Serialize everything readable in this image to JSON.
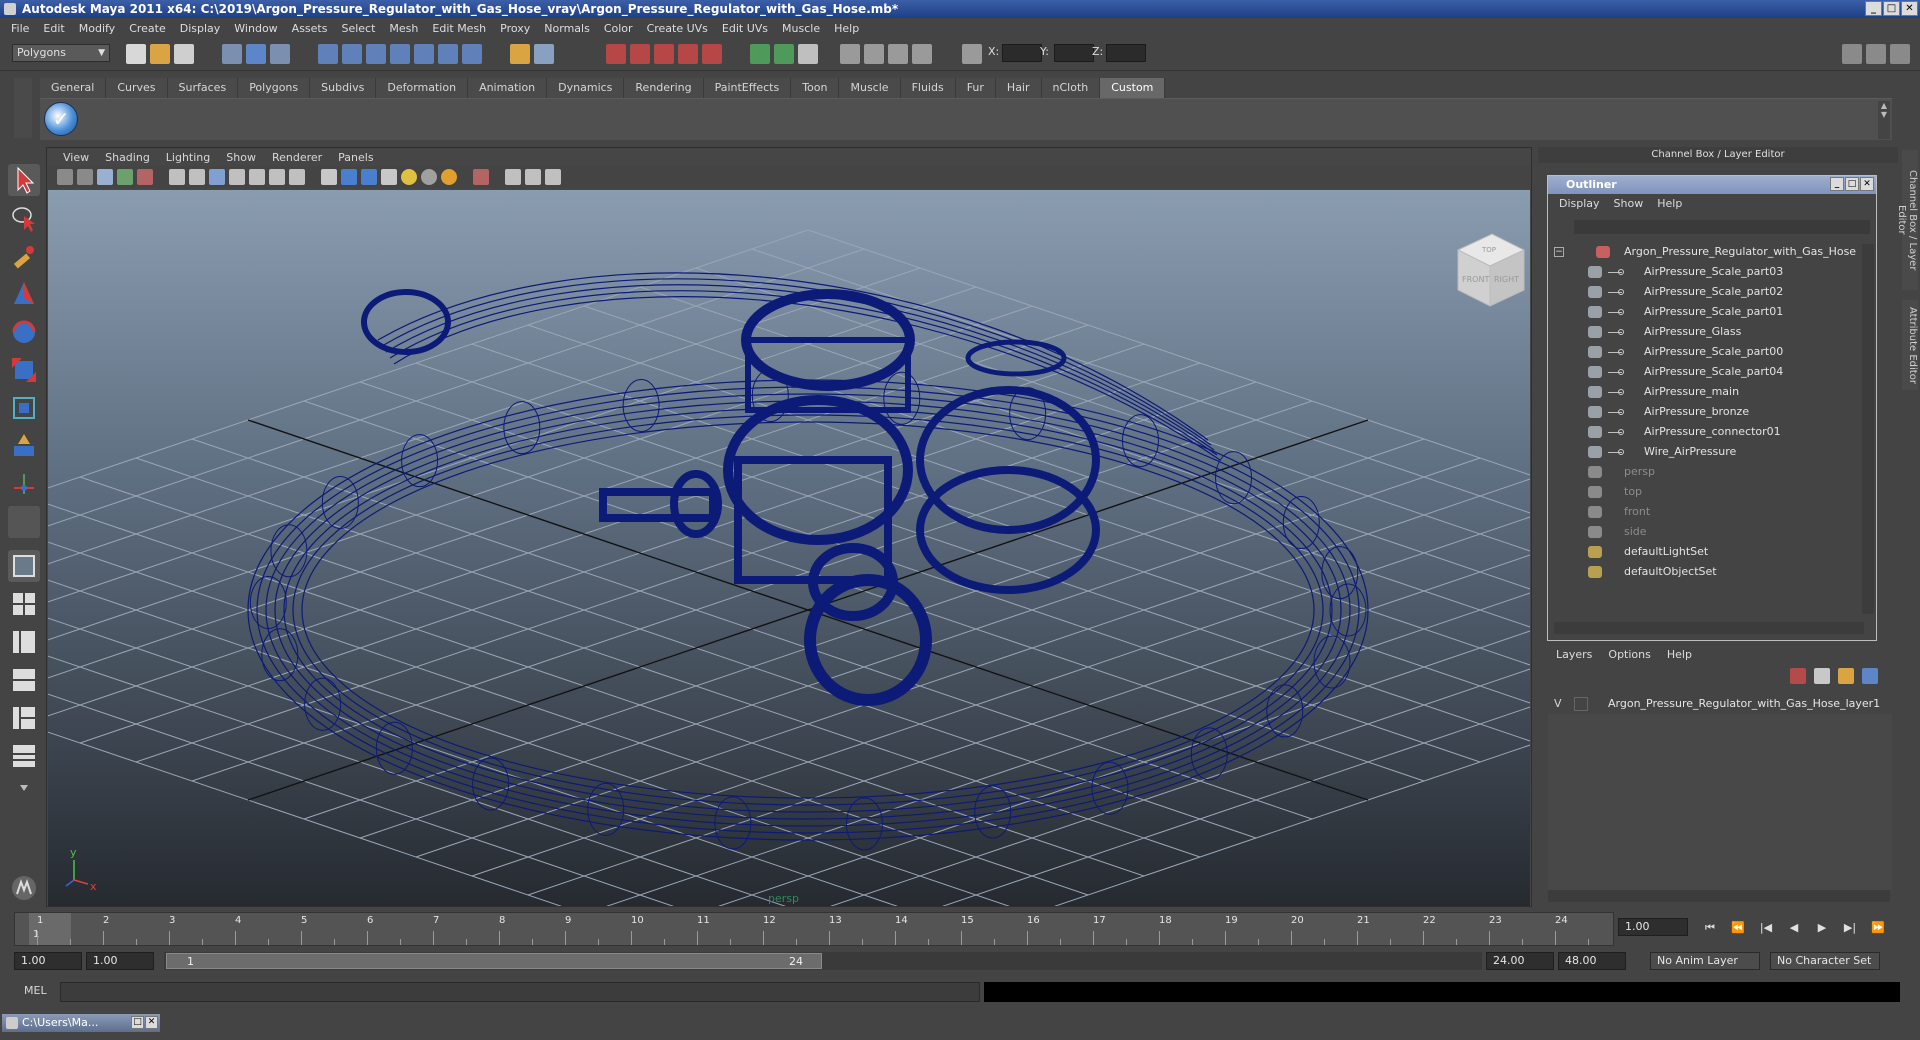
{
  "window": {
    "title": "Autodesk Maya 2011 x64: C:\\2019\\Argon_Pressure_Regulator_with_Gas_Hose_vray\\Argon_Pressure_Regulator_with_Gas_Hose.mb*",
    "minimize": "_",
    "maximize": "□",
    "close": "✕"
  },
  "menubar": [
    "File",
    "Edit",
    "Modify",
    "Create",
    "Display",
    "Window",
    "Assets",
    "Select",
    "Mesh",
    "Edit Mesh",
    "Proxy",
    "Normals",
    "Color",
    "Create UVs",
    "Edit UVs",
    "Muscle",
    "Help"
  ],
  "statusline": {
    "mode": "Polygons",
    "x_label": "X:",
    "y_label": "Y:",
    "z_label": "Z:"
  },
  "shelf": {
    "tabs": [
      "General",
      "Curves",
      "Surfaces",
      "Polygons",
      "Subdivs",
      "Deformation",
      "Animation",
      "Dynamics",
      "Rendering",
      "PaintEffects",
      "Toon",
      "Muscle",
      "Fluids",
      "Fur",
      "Hair",
      "nCloth",
      "Custom"
    ],
    "active_tab": "Custom",
    "checkmark": "✓"
  },
  "viewport": {
    "menu": [
      "View",
      "Shading",
      "Lighting",
      "Show",
      "Renderer",
      "Panels"
    ],
    "camera": "persp",
    "wire_color": "#0c1a78",
    "grid_color": "#9aa6b6",
    "axis_y": "y",
    "axis_x": "x",
    "viewcube_front": "FRONT",
    "viewcube_right": "RIGHT",
    "viewcube_top": "TOP"
  },
  "channel_box": {
    "title": "Channel Box / Layer Editor",
    "side_tab_1": "Channel Box / Layer Editor",
    "side_tab_2": "Attribute Editor"
  },
  "outliner": {
    "title": "Outliner",
    "menu": [
      "Display",
      "Show",
      "Help"
    ],
    "collapse": "−",
    "root": "Argon_Pressure_Regulator_with_Gas_Hose",
    "children": [
      "AirPressure_Scale_part03",
      "AirPressure_Scale_part02",
      "AirPressure_Scale_part01",
      "AirPressure_Glass",
      "AirPressure_Scale_part00",
      "AirPressure_Scale_part04",
      "AirPressure_main",
      "AirPressure_bronze",
      "AirPressure_connector01",
      "Wire_AirPressure"
    ],
    "cameras": [
      "persp",
      "top",
      "front",
      "side"
    ],
    "sets": [
      "defaultLightSet",
      "defaultObjectSet"
    ]
  },
  "layers": {
    "menu": [
      "Layers",
      "Options",
      "Help"
    ],
    "visibility": "V",
    "layer_name": "Argon_Pressure_Regulator_with_Gas_Hose_layer1"
  },
  "timeline": {
    "ticks": [
      "1",
      "2",
      "3",
      "4",
      "5",
      "6",
      "7",
      "8",
      "9",
      "10",
      "11",
      "12",
      "13",
      "14",
      "15",
      "16",
      "17",
      "18",
      "19",
      "20",
      "21",
      "22",
      "23",
      "24"
    ],
    "current_marker": "1",
    "current_frame": "1.00",
    "playback": [
      "⏮",
      "⏪",
      "|◀",
      "◀",
      "▶",
      "▶|",
      "⏩",
      "⏭"
    ]
  },
  "range": {
    "start": "1.00",
    "playback_start": "1.00",
    "range_start_label": "1",
    "range_end_label": "24",
    "playback_end": "24.00",
    "end": "48.00",
    "anim_layer": "No Anim Layer",
    "character_set": "No Character Set"
  },
  "cmdline": {
    "label": "MEL"
  },
  "taskbar": {
    "item": "C:\\Users\\Ma..."
  }
}
